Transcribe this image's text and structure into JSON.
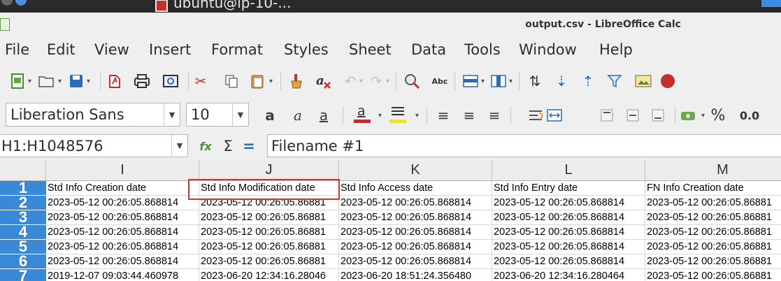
{
  "taskbar": {
    "item_label": "ubuntu@ip-10-..."
  },
  "window": {
    "title": "output.csv - LibreOffice Calc"
  },
  "menu": [
    "File",
    "Edit",
    "View",
    "Insert",
    "Format",
    "Styles",
    "Sheet",
    "Data",
    "Tools",
    "Window",
    "Help"
  ],
  "format_bar": {
    "font_name": "Liberation Sans",
    "font_size": "10",
    "percent_label": "%",
    "decimal_label": "0.0"
  },
  "formula_bar": {
    "name_box": "H1:H1048576",
    "function_symbol": "Σ",
    "equals_symbol": "=",
    "content": "Filename #1"
  },
  "grid": {
    "columns": [
      "I",
      "J",
      "K",
      "L",
      "M"
    ],
    "rows": [
      "1",
      "2",
      "3",
      "4",
      "5",
      "6",
      "7"
    ],
    "cells": [
      [
        "Std Info Creation date",
        "Std Info Modification date",
        "Std Info Access date",
        "Std Info Entry date",
        "FN Info Creation date"
      ],
      [
        "2023-05-12 00:26:05.868814",
        "2023-05-12 00:26:05.86881",
        "2023-05-12 00:26:05.868814",
        "2023-05-12 00:26:05.868814",
        "2023-05-12 00:26:05.86881"
      ],
      [
        "2023-05-12 00:26:05.868814",
        "2023-05-12 00:26:05.86881",
        "2023-05-12 00:26:05.868814",
        "2023-05-12 00:26:05.868814",
        "2023-05-12 00:26:05.86881"
      ],
      [
        "2023-05-12 00:26:05.868814",
        "2023-05-12 00:26:05.86881",
        "2023-05-12 00:26:05.868814",
        "2023-05-12 00:26:05.868814",
        "2023-05-12 00:26:05.86881"
      ],
      [
        "2023-05-12 00:26:05.868814",
        "2023-05-12 00:26:05.86881",
        "2023-05-12 00:26:05.868814",
        "2023-05-12 00:26:05.868814",
        "2023-05-12 00:26:05.86881"
      ],
      [
        "2023-05-12 00:26:05.868814",
        "2023-05-12 00:26:05.86881",
        "2023-05-12 00:26:05.868814",
        "2023-05-12 00:26:05.868814",
        "2023-05-12 00:26:05.86881"
      ],
      [
        "2019-12-07 09:03:44.460978",
        "2023-06-20 12:34:16.28046",
        "2023-06-20 18:51:24.356480",
        "2023-06-20 12:34:16.280464",
        "2023-05-12 00:26:05.86881"
      ]
    ]
  },
  "colors": {
    "row_header_bg": "#3a89d6",
    "highlight_border": "#e03030",
    "window_bg": "#efefef"
  }
}
